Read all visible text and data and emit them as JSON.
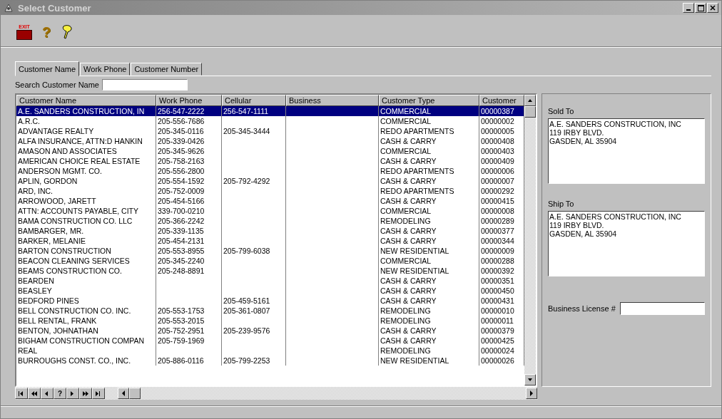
{
  "window": {
    "title": "Select Customer"
  },
  "toolbar": [
    {
      "kind": "exit",
      "label": "EXIT"
    },
    {
      "kind": "help",
      "label": "?"
    },
    {
      "kind": "tool"
    }
  ],
  "tabs": [
    {
      "label": "Customer Name",
      "selected": true
    },
    {
      "label": "Work Phone",
      "selected": false
    },
    {
      "label": "Customer Number",
      "selected": false
    }
  ],
  "search": {
    "label": "Search Customer Name"
  },
  "table": {
    "columns": [
      "Customer Name",
      "Work Phone",
      "Cellular",
      "Business",
      "Customer Type",
      "Customer"
    ],
    "rows": [
      {
        "name": "A.E. SANDERS CONSTRUCTION, IN",
        "work_phone": "256-547-2222",
        "cellular": "256-547-1111",
        "customer_type": "COMMERCIAL",
        "customer_number": "00000387",
        "selected": true
      },
      {
        "name": "A.R.C.",
        "work_phone": "205-556-7686",
        "customer_type": "COMMERCIAL",
        "customer_number": "00000002",
        "selected": false
      },
      {
        "name": "ADVANTAGE REALTY",
        "work_phone": "205-345-0116",
        "cellular": "205-345-3444",
        "customer_type": "REDO APARTMENTS",
        "customer_number": "00000005",
        "selected": false
      },
      {
        "name": "ALFA INSURANCE, ATTN:D HANKIN",
        "work_phone": "205-339-0426",
        "customer_type": "CASH & CARRY",
        "customer_number": "00000408",
        "selected": false
      },
      {
        "name": "AMASON AND ASSOCIATES",
        "work_phone": "205-345-9626",
        "customer_type": "COMMERCIAL",
        "customer_number": "00000403",
        "selected": false
      },
      {
        "name": "AMERICAN CHOICE REAL ESTATE",
        "work_phone": "205-758-2163",
        "customer_type": "CASH & CARRY",
        "customer_number": "00000409",
        "selected": false
      },
      {
        "name": "ANDERSON MGMT. CO.",
        "work_phone": "205-556-2800",
        "customer_type": "REDO APARTMENTS",
        "customer_number": "00000006",
        "selected": false
      },
      {
        "name": "APLIN, GORDON",
        "work_phone": "205-554-1592",
        "cellular": "205-792-4292",
        "customer_type": "CASH & CARRY",
        "customer_number": "00000007",
        "selected": false
      },
      {
        "name": "ARD, INC.",
        "work_phone": "205-752-0009",
        "customer_type": "REDO APARTMENTS",
        "customer_number": "00000292",
        "selected": false
      },
      {
        "name": "ARROWOOD, JARETT",
        "work_phone": "205-454-5166",
        "customer_type": "CASH & CARRY",
        "customer_number": "00000415",
        "selected": false
      },
      {
        "name": "ATTN:  ACCOUNTS PAYABLE, CITY",
        "work_phone": "339-700-0210",
        "customer_type": "COMMERCIAL",
        "customer_number": "00000008",
        "selected": false
      },
      {
        "name": "BAMA CONSTRUCTION CO. LLC",
        "work_phone": "205-366-2242",
        "customer_type": "REMODELING",
        "customer_number": "00000289",
        "selected": false
      },
      {
        "name": "BAMBARGER, MR.",
        "work_phone": "205-339-1135",
        "customer_type": "CASH & CARRY",
        "customer_number": "00000377",
        "selected": false
      },
      {
        "name": "BARKER, MELANIE",
        "work_phone": "205-454-2131",
        "customer_type": "CASH & CARRY",
        "customer_number": "00000344",
        "selected": false
      },
      {
        "name": "BARTON CONSTRUCTION",
        "work_phone": "205-553-8955",
        "cellular": "205-799-6038",
        "customer_type": "NEW RESIDENTIAL",
        "customer_number": "00000009",
        "selected": false
      },
      {
        "name": "BEACON CLEANING SERVICES",
        "work_phone": "205-345-2240",
        "customer_type": "COMMERCIAL",
        "customer_number": "00000288",
        "selected": false
      },
      {
        "name": "BEAMS CONSTRUCTION CO.",
        "work_phone": "205-248-8891",
        "customer_type": "NEW RESIDENTIAL",
        "customer_number": "00000392",
        "selected": false
      },
      {
        "name": "BEARDEN",
        "customer_type": "CASH & CARRY",
        "customer_number": "00000351",
        "selected": false
      },
      {
        "name": "BEASLEY",
        "customer_type": "CASH & CARRY",
        "customer_number": "00000450",
        "selected": false
      },
      {
        "name": "BEDFORD PINES",
        "cellular": "205-459-5161",
        "customer_type": "CASH & CARRY",
        "customer_number": "00000431",
        "selected": false
      },
      {
        "name": "BELL CONSTRUCTION CO. INC.",
        "work_phone": "205-553-1753",
        "cellular": "205-361-0807",
        "customer_type": "REMODELING",
        "customer_number": "00000010",
        "selected": false
      },
      {
        "name": "BELL RENTAL, FRANK",
        "work_phone": "205-553-2015",
        "customer_type": "REMODELING",
        "customer_number": "00000011",
        "selected": false
      },
      {
        "name": "BENTON, JOHNATHAN",
        "work_phone": "205-752-2951",
        "cellular": "205-239-9576",
        "customer_type": "CASH & CARRY",
        "customer_number": "00000379",
        "selected": false
      },
      {
        "name": "BIGHAM CONSTRUCTION COMPAN",
        "work_phone": "205-759-1969",
        "customer_type": "CASH & CARRY",
        "customer_number": "00000425",
        "selected": false
      },
      {
        "name": "REAL",
        "customer_type": "REMODELING",
        "customer_number": "00000024",
        "selected": false
      },
      {
        "name": "BURROUGHS CONST. CO., INC.",
        "work_phone": "205-886-0116",
        "cellular": "205-799-2253",
        "customer_type": "NEW RESIDENTIAL",
        "customer_number": "00000026",
        "selected": false
      }
    ]
  },
  "navigator": [
    {
      "kind": "first"
    },
    {
      "kind": "prev_page"
    },
    {
      "kind": "prev"
    },
    {
      "kind": "help",
      "label": "?"
    },
    {
      "kind": "next"
    },
    {
      "kind": "next_page"
    },
    {
      "kind": "last"
    }
  ],
  "details": {
    "sold_to": {
      "label": "Sold To",
      "lines": [
        "A.E. SANDERS CONSTRUCTION, INC",
        "119 IRBY BLVD.",
        "GASDEN, AL  35904"
      ]
    },
    "ship_to": {
      "label": "Ship To",
      "lines": [
        "A.E. SANDERS CONSTRUCTION, INC",
        "119 IRBY BLVD.",
        "GASDEN, AL  35904"
      ]
    },
    "business_license": {
      "label": "Business License #"
    }
  }
}
